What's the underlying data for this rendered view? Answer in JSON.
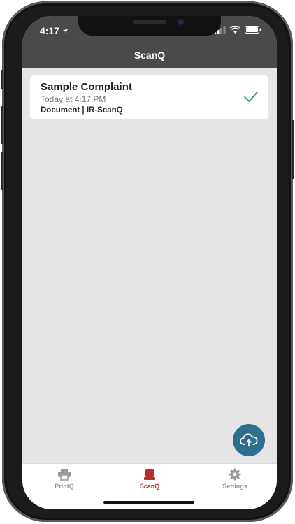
{
  "status_bar": {
    "time": "4:17"
  },
  "header": {
    "title": "ScanQ"
  },
  "jobs": [
    {
      "title": "Sample Complaint",
      "time": "Today at 4:17 PM",
      "meta": "Document | IR-ScanQ",
      "status_icon": "checkmark-icon"
    }
  ],
  "fab": {
    "icon": "cloud-upload-icon"
  },
  "tabs": [
    {
      "label": "PrintQ",
      "icon": "printer-icon"
    },
    {
      "label": "ScanQ",
      "icon": "scanner-icon"
    },
    {
      "label": "Settings",
      "icon": "gear-icon"
    }
  ],
  "colors": {
    "header_bg": "#4a4a4a",
    "accent_active_tab": "#b72d2d",
    "fab_bg": "#2e6f8e",
    "check_color": "#3aa76d"
  }
}
